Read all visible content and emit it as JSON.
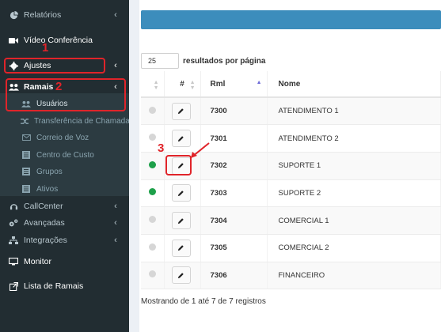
{
  "sidebar": {
    "items": [
      {
        "label": "Relatórios",
        "icon": "pie-chart-icon",
        "chevron": true
      },
      {
        "label": "Vídeo Conferência",
        "icon": "video-camera-icon",
        "chevron": false
      },
      {
        "label": "Ajustes",
        "icon": "cog-icon",
        "chevron": true
      },
      {
        "label": "Ramais",
        "icon": "users-icon",
        "chevron": true
      },
      {
        "label": "Usuários",
        "icon": "users-icon",
        "sub": true
      },
      {
        "label": "Transferência de Chamadas",
        "icon": "random-icon",
        "sub": true
      },
      {
        "label": "Correio de Voz",
        "icon": "envelope-icon",
        "sub": true
      },
      {
        "label": "Centro de Custo",
        "icon": "list-icon",
        "sub": true
      },
      {
        "label": "Grupos",
        "icon": "list-icon",
        "sub": true
      },
      {
        "label": "Ativos",
        "icon": "list-icon",
        "sub": true
      },
      {
        "label": "CallCenter",
        "icon": "headset-icon",
        "chevron": true
      },
      {
        "label": "Avançadas",
        "icon": "cogs-icon",
        "chevron": true
      },
      {
        "label": "Integrações",
        "icon": "sitemap-icon",
        "chevron": true
      },
      {
        "label": "Monitor",
        "icon": "desktop-icon",
        "chevron": false
      },
      {
        "label": "Lista de Ramais",
        "icon": "external-link-icon",
        "chevron": false
      }
    ]
  },
  "annotations": {
    "n1": "1",
    "n2": "2",
    "n3": "3"
  },
  "table_controls": {
    "page_size": "25",
    "page_size_label": "resultados por página"
  },
  "table": {
    "headers": {
      "edit": "#",
      "rml": "Rml",
      "nome": "Nome"
    },
    "rows": [
      {
        "status": "offline",
        "rml": "7300",
        "nome": "ATENDIMENTO 1"
      },
      {
        "status": "offline",
        "rml": "7301",
        "nome": "ATENDIMENTO 2"
      },
      {
        "status": "online",
        "rml": "7302",
        "nome": "SUPORTE 1"
      },
      {
        "status": "online",
        "rml": "7303",
        "nome": "SUPORTE 2"
      },
      {
        "status": "offline",
        "rml": "7304",
        "nome": "COMERCIAL 1"
      },
      {
        "status": "offline",
        "rml": "7305",
        "nome": "COMERCIAL 2"
      },
      {
        "status": "offline",
        "rml": "7306",
        "nome": "FINANCEIRO"
      }
    ]
  },
  "footer": {
    "text": "Mostrando de 1 até 7 de 7 registros"
  },
  "colors": {
    "sidebar_bg": "#222d32",
    "header_bar": "#3c8dbc",
    "annotation": "#e0242a",
    "online": "#1ea04a",
    "offline": "#d6d6d6"
  }
}
